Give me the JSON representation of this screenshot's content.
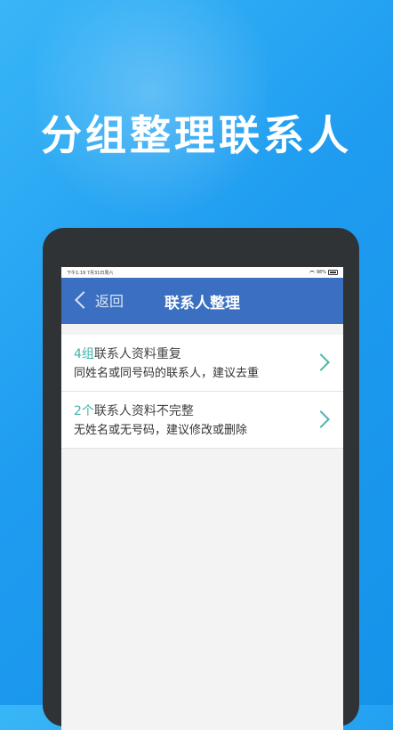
{
  "headline": "分组整理联系人",
  "status_bar": {
    "time": "下午1:19",
    "date": "7月31日周六",
    "battery": "98%"
  },
  "nav": {
    "back_label": "返回",
    "title": "联系人整理"
  },
  "items": [
    {
      "count": "4组",
      "title": "联系人资料重复",
      "subtitle": "同姓名或同号码的联系人，建议去重"
    },
    {
      "count": "2个",
      "title": "联系人资料不完整",
      "subtitle": "无姓名或无号码，建议修改或删除"
    }
  ],
  "colors": {
    "background": "#1f9cf0",
    "navbar": "#3a6fc2",
    "accent": "#42b3a6",
    "tablet_frame": "#2f3336"
  },
  "icons": [
    "chevron-left-icon",
    "chevron-right-icon",
    "wifi-icon",
    "battery-icon"
  ]
}
